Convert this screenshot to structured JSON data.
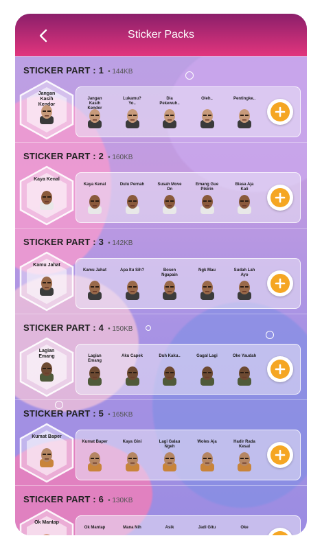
{
  "header": {
    "title": "Sticker Packs"
  },
  "colors": {
    "accent": "#f5a623",
    "header_top": "#8b1f6a",
    "header_bottom": "#e2357d"
  },
  "packs": [
    {
      "name": "STICKER PART : 1",
      "size": "144KB",
      "stickers": [
        "Jangan Kasih Kendor",
        "Lukamu? Yo..",
        "Dia Pekewuh..",
        "Oleh..",
        "Pentingke.."
      ]
    },
    {
      "name": "STICKER PART : 2",
      "size": "160KB",
      "stickers": [
        "Kaya Kenal",
        "Dulu Pernah",
        "Susah Move On",
        "Emang Gue Pikirin",
        "Biasa Aja Kali"
      ]
    },
    {
      "name": "STICKER PART : 3",
      "size": "142KB",
      "stickers": [
        "Kamu Jahat",
        "Apa Itu Sih?",
        "Bosen Ngapain",
        "Ngk Mau",
        "Sudah Lah Ayo"
      ]
    },
    {
      "name": "STICKER PART : 4",
      "size": "150KB",
      "stickers": [
        "Lagian Emang",
        "Aku Capek",
        "Duh Kaku..",
        "Gagal Lagi",
        "Oke Yaudah"
      ]
    },
    {
      "name": "STICKER PART : 5",
      "size": "165KB",
      "stickers": [
        "Kumat Baper",
        "Kaya Gini",
        "Lagi Galau Ngeh",
        "Woles Aja",
        "Hadir Rada Kesal"
      ]
    },
    {
      "name": "STICKER PART : 6",
      "size": "130KB",
      "stickers": [
        "Ok Mantap",
        "Mana Nih",
        "Asik",
        "Jadi Gitu",
        "Oke"
      ]
    }
  ]
}
